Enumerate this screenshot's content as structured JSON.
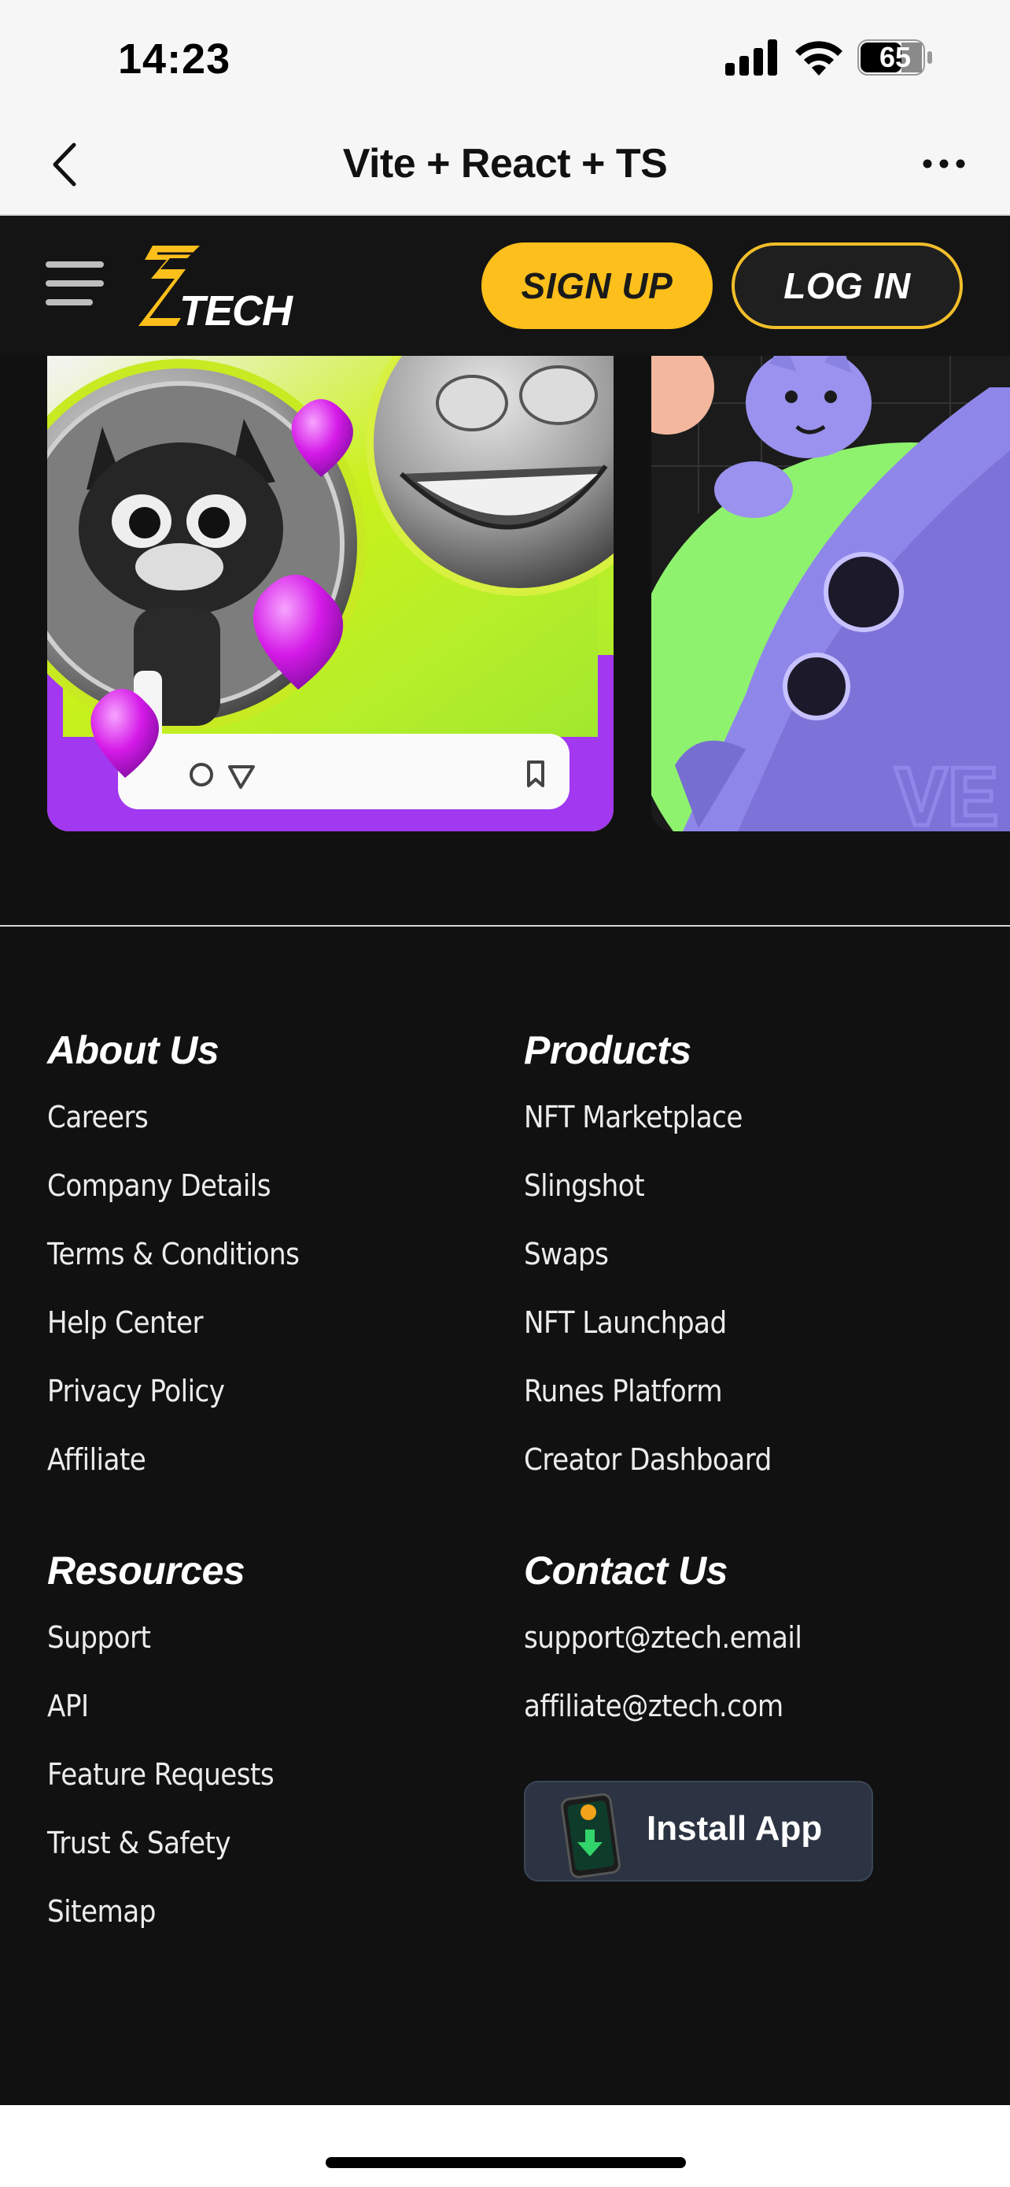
{
  "status_bar": {
    "time": "14:23",
    "battery": "65",
    "icons": [
      "cellular-signal-icon",
      "wifi-icon",
      "battery-icon"
    ]
  },
  "browser": {
    "title": "Vite + React + TS",
    "icons": [
      "back-chevron-icon",
      "more-options-icon"
    ]
  },
  "header": {
    "logo_text": "TECH",
    "signup_label": "SIGN UP",
    "login_label": "LOG IN",
    "accent_color": "#fcbf1b"
  },
  "carousel": {
    "cards": [
      "nft-card-cat-frog",
      "nft-card-rocket-dog"
    ],
    "card2_text": "VE"
  },
  "footer": {
    "about": {
      "heading": "About Us",
      "links": [
        "Careers",
        "Company Details",
        "Terms & Conditions",
        "Help Center",
        "Privacy Policy",
        "Affiliate"
      ]
    },
    "products": {
      "heading": "Products",
      "links": [
        "NFT Marketplace",
        "Slingshot",
        "Swaps",
        "NFT Launchpad",
        "Runes Platform",
        "Creator Dashboard"
      ]
    },
    "resources": {
      "heading": "Resources",
      "links": [
        "Support",
        "API",
        "Feature Requests",
        "Trust & Safety",
        "Sitemap"
      ]
    },
    "contact": {
      "heading": "Contact Us",
      "links": [
        "support@ztech.email",
        "affiliate@ztech.com"
      ]
    },
    "install_label": "Install App"
  }
}
